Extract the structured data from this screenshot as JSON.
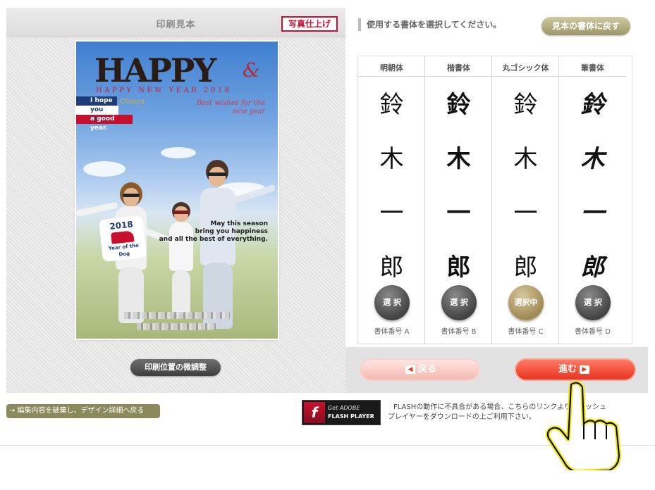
{
  "left_panel": {
    "title": "印刷見本",
    "photo_badge": "写真仕上げ",
    "fine_adjust_label": "印刷位置の微調整"
  },
  "card": {
    "happy": "HAPPY",
    "amp": "&",
    "hny": "HAPPY NEW YEAR 2018",
    "flag_line1": "I hope",
    "flag_line2": "you have",
    "flag_line3": "a good year.",
    "cheers": "Cheers",
    "best_line1": "Best wishes for the",
    "best_line2": "new year",
    "dog_year": "2018",
    "dog_text1": "Year of the",
    "dog_text2": "Dog",
    "msg_line1": "May this season",
    "msg_line2": "bring you happiness",
    "msg_line3": "and all the best of everything."
  },
  "right_panel": {
    "header": "使用する書体を選択してください。",
    "reset_label": "見本の書体に戻す",
    "sample_chars": [
      "鈴",
      "木",
      "一",
      "郎"
    ],
    "fonts": [
      {
        "name": "明朝体",
        "select_label": "選 択",
        "code": "書体番号 A",
        "selected": false
      },
      {
        "name": "楷書体",
        "select_label": "選 択",
        "code": "書体番号 B",
        "selected": false
      },
      {
        "name": "丸ゴシック体",
        "select_label": "選択中",
        "code": "書体番号 C",
        "selected": true
      },
      {
        "name": "筆書体",
        "select_label": "選 択",
        "code": "書体番号 D",
        "selected": false
      }
    ],
    "back_label": "戻る",
    "next_label": "進む"
  },
  "footer": {
    "edit_link": "→ 編集内容を破棄し、デザイン詳細へ戻る",
    "flash_get": "Get ADOBE",
    "flash_player": "FLASH PLAYER",
    "flash_note": "FLASHの動作に不具合がある場合、こちらのリンクよりフラッシュプレイヤーをダウンロードの上ご利用下さい。"
  },
  "colors": {
    "accent_red": "#e8331d",
    "badge_red": "#c8102e",
    "reset_olive": "#9d9668",
    "selected_gold": "#a08a55"
  }
}
